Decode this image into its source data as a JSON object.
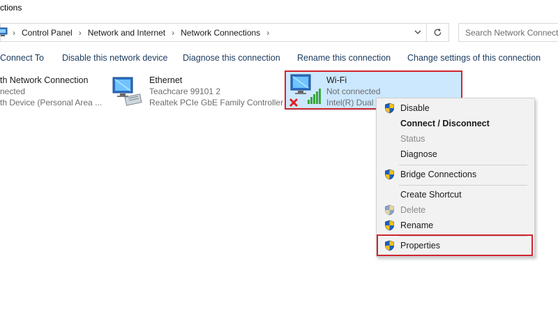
{
  "window": {
    "title": "ctions"
  },
  "address_bar": {
    "crumbs": [
      "Control Panel",
      "Network and Internet",
      "Network Connections"
    ],
    "search_placeholder": "Search Network Connections"
  },
  "toolbar": {
    "connect_to": "Connect To",
    "disable_device": "Disable this network device",
    "diagnose": "Diagnose this connection",
    "rename": "Rename this connection",
    "change_settings": "Change settings of this connection"
  },
  "connections": [
    {
      "name": "th Network Connection",
      "status": "nected",
      "device": "th Device (Personal Area ..."
    },
    {
      "name": "Ethernet",
      "status": "Teachcare  99101 2",
      "device": "Realtek PCIe GbE Family Controller"
    },
    {
      "name": "Wi-Fi",
      "status": "Not connected",
      "device": "Intel(R) Dual B"
    }
  ],
  "context_menu": {
    "disable": "Disable",
    "connect_disconnect": "Connect / Disconnect",
    "status": "Status",
    "diagnose": "Diagnose",
    "bridge": "Bridge Connections",
    "shortcut": "Create Shortcut",
    "delete": "Delete",
    "rename": "Rename",
    "properties": "Properties"
  },
  "colors": {
    "highlight_red": "#d0262e",
    "selection_blue": "#cce8ff",
    "toolbar_text": "#1a3a5e"
  }
}
